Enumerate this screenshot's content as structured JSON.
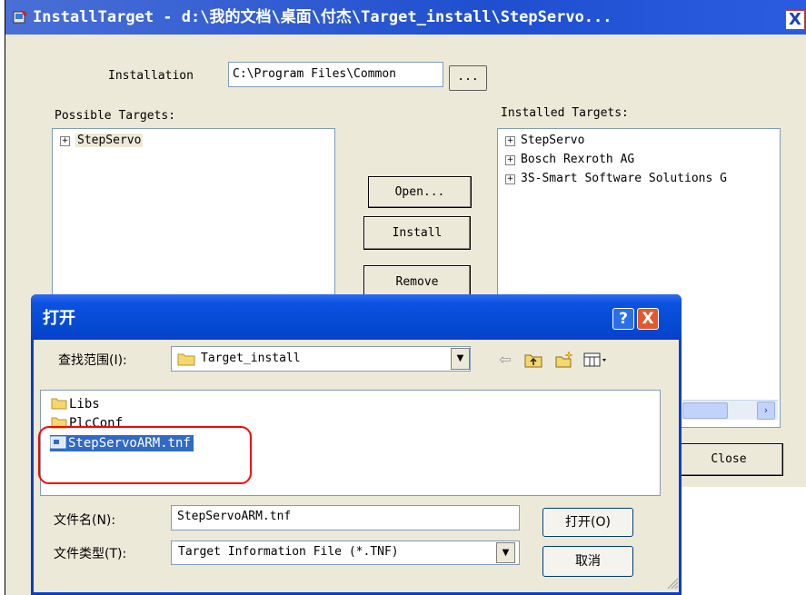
{
  "background_window": {
    "title": "InstallTarget - d:\\我的文档\\桌面\\付杰\\Target_install\\StepServo...",
    "close_glyph": "X",
    "installation_label": "Installation",
    "installation_value": "C:\\Program Files\\Common",
    "browse_label": "...",
    "possible_targets_label": "Possible Targets:",
    "installed_targets_label": "Installed Targets:",
    "possible_targets": [
      "StepServo"
    ],
    "installed_targets": [
      "StepServo",
      "Bosch Rexroth AG",
      "3S-Smart Software Solutions G"
    ],
    "buttons": {
      "open": "Open...",
      "install": "Install",
      "remove": "Remove",
      "close": "Close"
    },
    "scroll_right_glyph": "›"
  },
  "dialog": {
    "title": "打开",
    "help_glyph": "?",
    "close_glyph": "X",
    "look_in_label": "查找范围(I):",
    "look_in_value": "Target_install",
    "toolbar_icons": [
      "back-icon",
      "up-folder-icon",
      "new-folder-icon",
      "views-menu-icon"
    ],
    "files": [
      {
        "name": "Libs",
        "type": "folder"
      },
      {
        "name": "PlcConf",
        "type": "folder"
      },
      {
        "name": "StepServoARM.tnf",
        "type": "file",
        "selected": true
      }
    ],
    "file_name_label": "文件名(N):",
    "file_name_value": "StepServoARM.tnf",
    "file_type_label": "文件类型(T):",
    "file_type_value": "Target Information File (*.TNF)",
    "open_button": "打开(O)",
    "cancel_button": "取消"
  },
  "colors": {
    "xp_blue": "#0a3ec9",
    "window_face": "#ece9d8",
    "selection": "#316ac5",
    "highlight_ring": "#ff0000"
  }
}
